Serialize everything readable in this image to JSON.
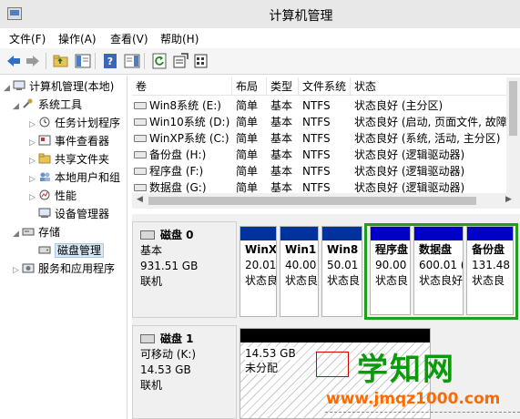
{
  "window": {
    "title": "计算机管理",
    "icon": "computer-management-icon"
  },
  "menu": [
    "文件(F)",
    "操作(A)",
    "查看(V)",
    "帮助(H)"
  ],
  "toolbar": [
    "back-icon",
    "forward-icon",
    "up-folder-icon",
    "show-hide-tree-icon",
    "help-icon",
    "show-action-pane-icon",
    "refresh-icon",
    "properties-icon",
    "export-icon"
  ],
  "tree": {
    "root": "计算机管理(本地)",
    "system_tools": "系统工具",
    "task_scheduler": "任务计划程序",
    "event_viewer": "事件查看器",
    "shared_folders": "共享文件夹",
    "local_users": "本地用户和组",
    "performance": "性能",
    "device_manager": "设备管理器",
    "storage": "存储",
    "disk_management": "磁盘管理",
    "services": "服务和应用程序"
  },
  "volumes": {
    "headers": [
      "卷",
      "布局",
      "类型",
      "文件系统",
      "状态"
    ],
    "rows": [
      {
        "name": "Win8系统 (E:)",
        "layout": "简单",
        "type": "基本",
        "fs": "NTFS",
        "status": "状态良好 (主分区)"
      },
      {
        "name": "Win10系统 (D:)",
        "layout": "简单",
        "type": "基本",
        "fs": "NTFS",
        "status": "状态良好 (启动, 页面文件, 故障"
      },
      {
        "name": "WinXP系统 (C:)",
        "layout": "简单",
        "type": "基本",
        "fs": "NTFS",
        "status": "状态良好 (系统, 活动, 主分区)"
      },
      {
        "name": "备份盘 (H:)",
        "layout": "简单",
        "type": "基本",
        "fs": "NTFS",
        "status": "状态良好 (逻辑驱动器)"
      },
      {
        "name": "程序盘 (F:)",
        "layout": "简单",
        "type": "基本",
        "fs": "NTFS",
        "status": "状态良好 (逻辑驱动器)"
      },
      {
        "name": "数据盘 (G:)",
        "layout": "简单",
        "type": "基本",
        "fs": "NTFS",
        "status": "状态良好 (逻辑驱动器)"
      }
    ]
  },
  "disk0": {
    "name": "磁盘 0",
    "type": "基本",
    "size": "931.51 GB",
    "status": "联机",
    "partitions": [
      {
        "name": "WinX",
        "size": "20.01",
        "status": "状态良"
      },
      {
        "name": "Win1",
        "size": "40.00",
        "status": "状态良"
      },
      {
        "name": "Win8",
        "size": "50.01",
        "status": "状态良"
      },
      {
        "name": "程序盘",
        "size": "90.00",
        "status": "状态良"
      },
      {
        "name": "数据盘",
        "size": "600.01 (",
        "status": "状态良好"
      },
      {
        "name": "备份盘",
        "size": "131.48",
        "status": "状态良"
      }
    ]
  },
  "disk1": {
    "name": "磁盘 1",
    "type": "可移动 (K:)",
    "size": "14.53 GB",
    "status": "联机",
    "unallocated": {
      "size": "14.53 GB",
      "status": "未分配"
    }
  },
  "watermark": {
    "title": "学知网",
    "url": "www.jmqz1000.com"
  }
}
